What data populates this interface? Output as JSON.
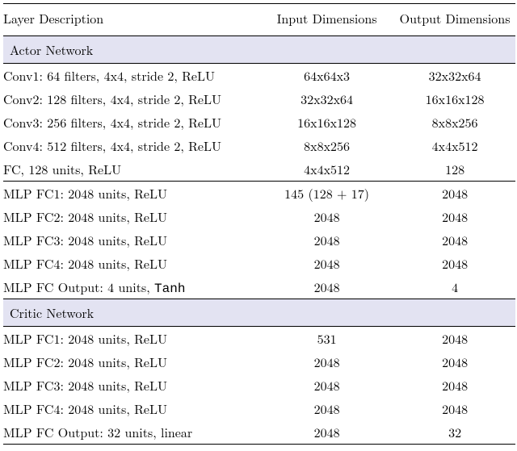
{
  "headers": {
    "layer_desc": "Layer Description",
    "input_dims": "Input Dimensions",
    "output_dims": "Output Dimensions"
  },
  "sections": {
    "actor": "Actor Network",
    "critic": "Critic Network"
  },
  "actor_group1": [
    {
      "desc": "Conv1: 64 filters, 4x4, stride 2, ReLU",
      "in": "64x64x3",
      "out": "32x32x64"
    },
    {
      "desc": "Conv2: 128 filters, 4x4, stride 2, ReLU",
      "in": "32x32x64",
      "out": "16x16x128"
    },
    {
      "desc": "Conv3: 256 filters, 4x4, stride 2, ReLU",
      "in": "16x16x128",
      "out": "8x8x256"
    },
    {
      "desc": "Conv4: 512 filters, 4x4, stride 2, ReLU",
      "in": "8x8x256",
      "out": "4x4x512"
    },
    {
      "desc": "FC, 128 units, ReLU",
      "in": "4x4x512",
      "out": "128"
    }
  ],
  "actor_group2": [
    {
      "desc": "MLP FC1: 2048 units, ReLU",
      "in": "145 (128 + 17)",
      "out": "2048"
    },
    {
      "desc": "MLP FC2: 2048 units, ReLU",
      "in": "2048",
      "out": "2048"
    },
    {
      "desc": "MLP FC3: 2048 units, ReLU",
      "in": "2048",
      "out": "2048"
    },
    {
      "desc": "MLP FC4: 2048 units, ReLU",
      "in": "2048",
      "out": "2048"
    }
  ],
  "actor_group2_out": {
    "desc_pre": "MLP FC Output: 4 units, ",
    "desc_tanh": "Tanh",
    "in": "2048",
    "out": "4"
  },
  "critic_group": [
    {
      "desc": "MLP FC1: 2048 units, ReLU",
      "in": "531",
      "out": "2048"
    },
    {
      "desc": "MLP FC2: 2048 units, ReLU",
      "in": "2048",
      "out": "2048"
    },
    {
      "desc": "MLP FC3: 2048 units, ReLU",
      "in": "2048",
      "out": "2048"
    },
    {
      "desc": "MLP FC4: 2048 units, ReLU",
      "in": "2048",
      "out": "2048"
    },
    {
      "desc": "MLP FC Output: 32 units, linear",
      "in": "2048",
      "out": "32"
    }
  ]
}
